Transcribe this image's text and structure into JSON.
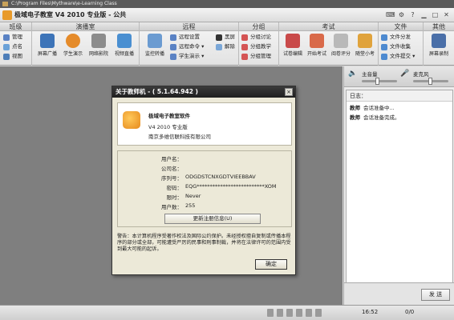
{
  "window": {
    "path": "C:\\Program Files\\Mythware\\e-Learning Class",
    "title": "极域电子教室 V4 2010 专业版 - 公共"
  },
  "toolbar": {
    "groups": [
      {
        "label": "班级"
      },
      {
        "label": "演播室"
      },
      {
        "label": "远程"
      },
      {
        "label": "分组"
      },
      {
        "label": "考试"
      },
      {
        "label": "文件"
      },
      {
        "label": "其他"
      }
    ],
    "class_items": [
      "管理",
      "点名",
      "视图"
    ],
    "studio_items": [
      "屏幕广播",
      "学生演示",
      "网络影院",
      "视频直播"
    ],
    "monitor_label": "监控转播",
    "remote_items": [
      "远程设置",
      "远程命令",
      "学生演示"
    ],
    "remote_lock_items": [
      "黑屏",
      "解除"
    ],
    "group_items": [
      "分组讨论",
      "分组教学",
      "分组管理"
    ],
    "exam_items": [
      "试卷编辑",
      "开始考试",
      "阅卷评分",
      "随堂小考"
    ],
    "file_items": [
      "文件分发",
      "文件收集",
      "文件提交"
    ],
    "other_items": [
      "屏幕录制"
    ]
  },
  "audio": {
    "speaker_label": "主音量",
    "mic_label": "麦克风",
    "speaker_level": 0.45,
    "mic_level": 0.5
  },
  "log": {
    "header": "日志：",
    "entries": [
      {
        "who": "教师",
        "msg": "会话准备中..."
      },
      {
        "who": "教师",
        "msg": "会话准备完成。"
      }
    ]
  },
  "send": {
    "label": "发 送"
  },
  "status": {
    "time": "16:52",
    "count": "0/0"
  },
  "dialog": {
    "title": "关于教师机 - ( 5.1.64.942 )",
    "close": "×",
    "product": "极域电子教室软件",
    "version": "V4 2010 专业版",
    "company": "南京多维信联科技有限公司",
    "fields": [
      {
        "key": "用户名：",
        "value": ""
      },
      {
        "key": "公司名：",
        "value": ""
      },
      {
        "key": "序列号：",
        "value": "ODGDSTCNXGDTVIEEBBAV"
      },
      {
        "key": "密码：",
        "value": "EQG**************************XOM"
      },
      {
        "key": "限时：",
        "value": "Never"
      },
      {
        "key": "用户数：",
        "value": "255"
      }
    ],
    "register_label": "更新注册信息(U)",
    "warning": "警告：本计算机程序受著作权法及国际公约保护。未经授权擅自复制或传播本程序的部分或全部，可能遭受严厉的民事和刑事制裁，并将在法律许可的范围内受到最大可能的起诉。",
    "ok_label": "确定"
  },
  "colors": {
    "titlebar": "#1f1f1f",
    "workspace": "#7f7f7f",
    "dialog_bg": "#ece9d8",
    "logo": "#e6891c"
  }
}
